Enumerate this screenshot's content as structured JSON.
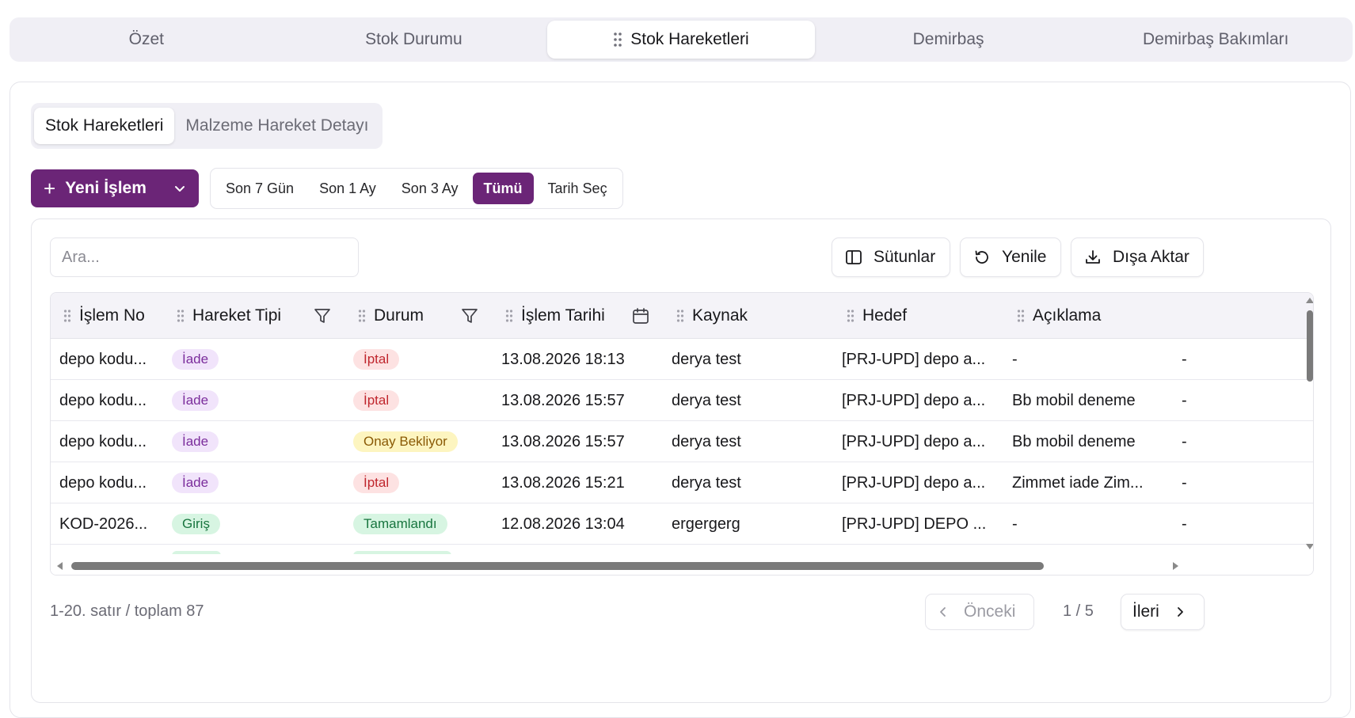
{
  "top_tabs": [
    {
      "label": "Özet"
    },
    {
      "label": "Stok Durumu"
    },
    {
      "label": "Stok Hareketleri"
    },
    {
      "label": "Demirbaş"
    },
    {
      "label": "Demirbaş Bakımları"
    }
  ],
  "sub_tabs": [
    {
      "label": "Stok Hareketleri"
    },
    {
      "label": "Malzeme Hareket Detayı"
    }
  ],
  "new_button": {
    "label": "Yeni İşlem"
  },
  "date_filters": [
    {
      "label": "Son 7 Gün"
    },
    {
      "label": "Son 1 Ay"
    },
    {
      "label": "Son 3 Ay"
    },
    {
      "label": "Tümü"
    },
    {
      "label": "Tarih Seç"
    }
  ],
  "search": {
    "placeholder": "Ara..."
  },
  "toolbar": {
    "columns_label": "Sütunlar",
    "refresh_label": "Yenile",
    "export_label": "Dışa Aktar"
  },
  "table": {
    "columns": [
      "İşlem No",
      "Hareket Tipi",
      "Durum",
      "İşlem Tarihi",
      "Kaynak",
      "Hedef",
      "Açıklama"
    ],
    "rows": [
      {
        "no": "depo kodu...",
        "type": "İade",
        "status": "İptal",
        "date": "13.08.2026 18:13",
        "source": "derya test",
        "target": "[PRJ-UPD] depo a...",
        "desc": "-",
        "extra": "-"
      },
      {
        "no": "depo kodu...",
        "type": "İade",
        "status": "İptal",
        "date": "13.08.2026 15:57",
        "source": "derya test",
        "target": "[PRJ-UPD] depo a...",
        "desc": "Bb mobil deneme",
        "extra": "-"
      },
      {
        "no": "depo kodu...",
        "type": "İade",
        "status": "Onay Bekliyor",
        "date": "13.08.2026 15:57",
        "source": "derya test",
        "target": "[PRJ-UPD] depo a...",
        "desc": "Bb mobil deneme",
        "extra": "-"
      },
      {
        "no": "depo kodu...",
        "type": "İade",
        "status": "İptal",
        "date": "13.08.2026 15:21",
        "source": "derya test",
        "target": "[PRJ-UPD] depo a...",
        "desc": "Zimmet iade Zim...",
        "extra": "-"
      },
      {
        "no": "KOD-2026...",
        "type": "Giriş",
        "status": "Tamamlandı",
        "date": "12.08.2026 13:04",
        "source": "ergergerg",
        "target": "[PRJ-UPD] DEPO ...",
        "desc": "-",
        "extra": "-"
      }
    ]
  },
  "pagination": {
    "range_text": "1-20. satır / toplam 87",
    "prev_label": "Önceki",
    "page_info": "1 / 5",
    "next_label": "İleri"
  },
  "colors": {
    "accent": "#6b2577",
    "iade_bg": "#f1e4fb",
    "iptal_bg": "#fde2e2",
    "onay_bg": "#fdf5c0",
    "success_bg": "#d7f5e2"
  }
}
